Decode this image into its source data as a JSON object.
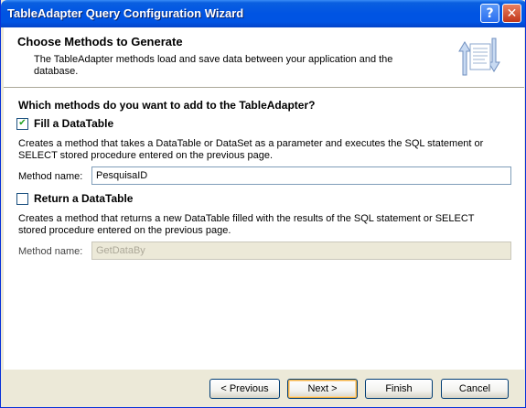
{
  "window": {
    "title": "TableAdapter Query Configuration Wizard",
    "help_symbol": "?",
    "close_symbol": "✕"
  },
  "header": {
    "title": "Choose Methods to Generate",
    "description": "The TableAdapter methods load and save data between your application and the database."
  },
  "main": {
    "question": "Which methods do you want to add to the TableAdapter?",
    "fill": {
      "label": "Fill a DataTable",
      "checked": true,
      "check_glyph": "✔",
      "description": "Creates a method that takes a DataTable or DataSet as a parameter and executes the SQL statement or SELECT stored procedure entered on the previous page.",
      "method_label": "Method name:",
      "method_value": "PesquisaID"
    },
    "return": {
      "label": "Return a DataTable",
      "checked": false,
      "description": "Creates a method that returns a new DataTable filled with the results of the SQL statement or SELECT stored procedure entered on the previous page.",
      "method_label": "Method name:",
      "method_value": "GetDataBy"
    }
  },
  "footer": {
    "previous": "< Previous",
    "next": "Next >",
    "finish": "Finish",
    "cancel": "Cancel"
  }
}
